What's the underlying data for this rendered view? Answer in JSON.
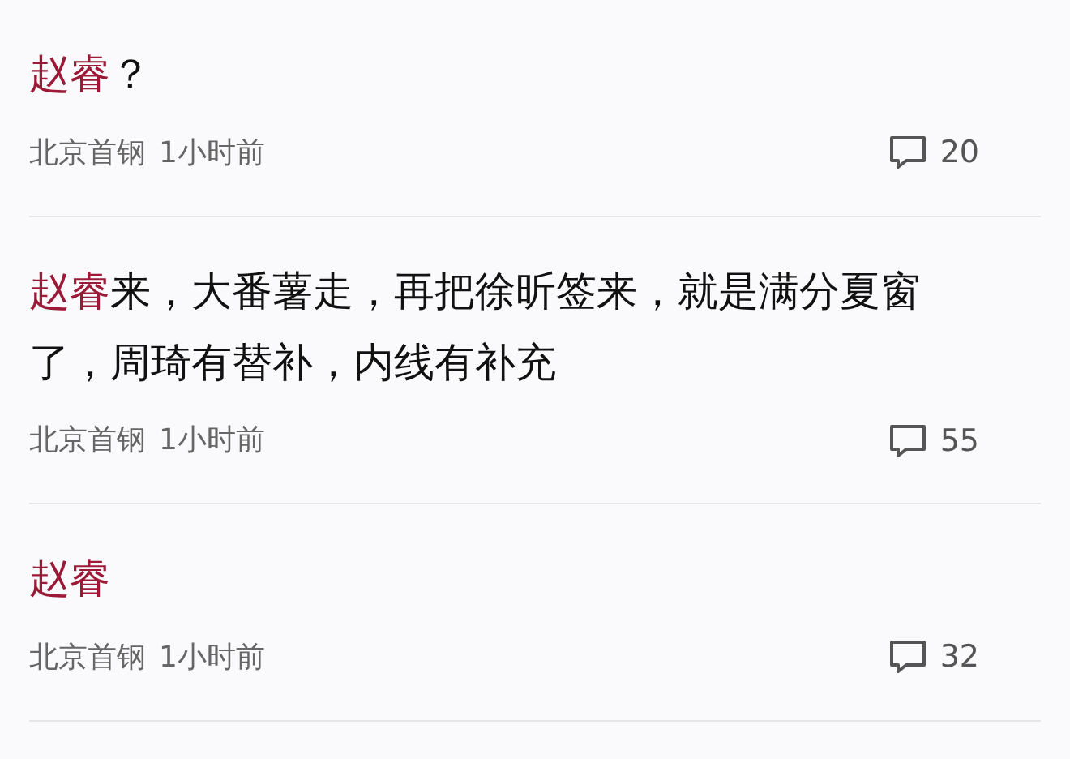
{
  "comments": [
    {
      "segments": [
        {
          "text": "赵睿",
          "highlighted": true
        },
        {
          "text": "？",
          "highlighted": false
        }
      ],
      "source": "北京首钢",
      "time": "1小时前",
      "reply_count": "20"
    },
    {
      "segments": [
        {
          "text": "赵睿",
          "highlighted": true
        },
        {
          "text": "来，大番薯走，再把徐昕签来，就是满分夏窗了，周琦有替补，内线有补充",
          "highlighted": false
        }
      ],
      "source": "北京首钢",
      "time": "1小时前",
      "reply_count": "55"
    },
    {
      "segments": [
        {
          "text": "赵睿",
          "highlighted": true
        }
      ],
      "source": "北京首钢",
      "time": "1小时前",
      "reply_count": "32"
    }
  ]
}
